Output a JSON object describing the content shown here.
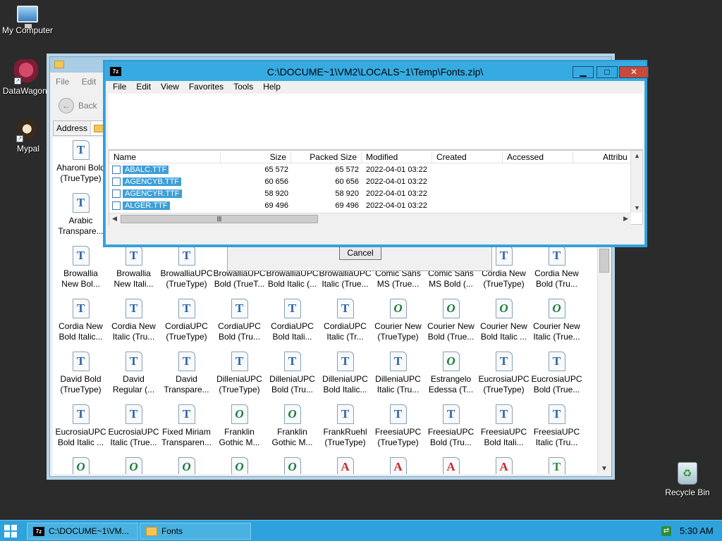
{
  "desktop": {
    "icons": [
      {
        "label": "My Computer"
      },
      {
        "label": "DataWagon."
      },
      {
        "label": "Mypal"
      },
      {
        "label": "Recycle Bin"
      }
    ]
  },
  "explorer": {
    "menu": [
      "File",
      "Edit"
    ],
    "back_label": "Back",
    "address_label": "Address",
    "cancel_label": "Cancel",
    "font_items": [
      {
        "l1": "Aharoni Bold",
        "l2": "(TrueType)",
        "icon": "tt"
      },
      {
        "l1": "Arabic",
        "l2": "Transpare...",
        "icon": "tt"
      },
      {
        "l1": "Browallia",
        "l2": "New Bol...",
        "icon": "tt"
      },
      {
        "l1": "Browallia",
        "l2": "New Itali...",
        "icon": "tt"
      },
      {
        "l1": "BrowalliaUPC",
        "l2": "(TrueType)",
        "icon": "tt"
      },
      {
        "l1": "BrowalliaUPC",
        "l2": "Bold (TrueT...",
        "icon": "tt"
      },
      {
        "l1": "BrowalliaUPC",
        "l2": "Bold Italic (...",
        "icon": "tt"
      },
      {
        "l1": "BrowalliaUPC",
        "l2": "Italic (True...",
        "icon": "tt"
      },
      {
        "l1": "Comic Sans",
        "l2": "MS (True...",
        "icon": "tt"
      },
      {
        "l1": "Comic Sans",
        "l2": "MS Bold (...",
        "icon": "tt"
      },
      {
        "l1": "Cordia New",
        "l2": "(TrueType)",
        "icon": "tt"
      },
      {
        "l1": "Cordia New",
        "l2": "Bold (Tru...",
        "icon": "tt"
      },
      {
        "l1": "Cordia New",
        "l2": "Bold Italic...",
        "icon": "tt"
      },
      {
        "l1": "Cordia New",
        "l2": "Italic (Tru...",
        "icon": "tt"
      },
      {
        "l1": "CordiaUPC",
        "l2": "(TrueType)",
        "icon": "tt"
      },
      {
        "l1": "CordiaUPC",
        "l2": "Bold (Tru...",
        "icon": "tt"
      },
      {
        "l1": "CordiaUPC",
        "l2": "Bold Itali...",
        "icon": "tt"
      },
      {
        "l1": "CordiaUPC",
        "l2": "Italic (Tr...",
        "icon": "tt"
      },
      {
        "l1": "Courier New",
        "l2": "(TrueType)",
        "icon": "ot"
      },
      {
        "l1": "Courier New",
        "l2": "Bold (True...",
        "icon": "ot"
      },
      {
        "l1": "Courier New",
        "l2": "Bold Italic ...",
        "icon": "ot"
      },
      {
        "l1": "Courier New",
        "l2": "Italic (True...",
        "icon": "ot"
      },
      {
        "l1": "David Bold",
        "l2": "(TrueType)",
        "icon": "tt"
      },
      {
        "l1": "David",
        "l2": "Regular (...",
        "icon": "tt"
      },
      {
        "l1": "David",
        "l2": "Transpare...",
        "icon": "tt"
      },
      {
        "l1": "DilleniaUPC",
        "l2": "(TrueType)",
        "icon": "tt"
      },
      {
        "l1": "DilleniaUPC",
        "l2": "Bold (Tru...",
        "icon": "tt"
      },
      {
        "l1": "DilleniaUPC",
        "l2": "Bold Italic...",
        "icon": "tt"
      },
      {
        "l1": "DilleniaUPC",
        "l2": "Italic (Tru...",
        "icon": "tt"
      },
      {
        "l1": "Estrangelo",
        "l2": "Edessa (T...",
        "icon": "ot"
      },
      {
        "l1": "EucrosiaUPC",
        "l2": "(TrueType)",
        "icon": "tt"
      },
      {
        "l1": "EucrosiaUPC",
        "l2": "Bold (True...",
        "icon": "tt"
      },
      {
        "l1": "EucrosiaUPC",
        "l2": "Bold Italic ...",
        "icon": "tt"
      },
      {
        "l1": "EucrosiaUPC",
        "l2": "Italic (True...",
        "icon": "tt"
      },
      {
        "l1": "Fixed Miriam",
        "l2": "Transparen...",
        "icon": "tt"
      },
      {
        "l1": "Franklin",
        "l2": "Gothic M...",
        "icon": "ot"
      },
      {
        "l1": "Franklin",
        "l2": "Gothic M...",
        "icon": "ot"
      },
      {
        "l1": "FrankRuehl",
        "l2": "(TrueType)",
        "icon": "tt"
      },
      {
        "l1": "FreesiaUPC",
        "l2": "(TrueType)",
        "icon": "tt"
      },
      {
        "l1": "FreesiaUPC",
        "l2": "Bold (Tru...",
        "icon": "tt"
      },
      {
        "l1": "FreesiaUPC",
        "l2": "Bold Itali...",
        "icon": "tt"
      },
      {
        "l1": "FreesiaUPC",
        "l2": "Italic (Tru...",
        "icon": "tt"
      },
      {
        "l1": "",
        "l2": "",
        "icon": "ot"
      },
      {
        "l1": "",
        "l2": "",
        "icon": "ot"
      },
      {
        "l1": "",
        "l2": "",
        "icon": "ot"
      },
      {
        "l1": "",
        "l2": "",
        "icon": "ot"
      },
      {
        "l1": "",
        "l2": "",
        "icon": "ot"
      },
      {
        "l1": "",
        "l2": "",
        "icon": "a"
      },
      {
        "l1": "",
        "l2": "",
        "icon": "a"
      },
      {
        "l1": "",
        "l2": "",
        "icon": "a"
      },
      {
        "l1": "",
        "l2": "",
        "icon": "a"
      },
      {
        "l1": "",
        "l2": "",
        "icon": "tt2"
      }
    ]
  },
  "zip": {
    "icon_text": "7z",
    "title": "C:\\DOCUME~1\\VM2\\LOCALS~1\\Temp\\Fonts.zip\\",
    "buttons": {
      "minimize": "▁",
      "maximize": "□",
      "close": "✕"
    },
    "menu": [
      "File",
      "Edit",
      "View",
      "Favorites",
      "Tools",
      "Help"
    ],
    "columns": [
      "Name",
      "Size",
      "Packed Size",
      "Modified",
      "Created",
      "Accessed",
      "Attribu"
    ],
    "rows": [
      {
        "name": "ABALC.TTF",
        "size": "65 572",
        "packed": "65 572",
        "modified": "2022-04-01 03:22"
      },
      {
        "name": "AGENCYB.TTF",
        "size": "60 656",
        "packed": "60 656",
        "modified": "2022-04-01 03:22"
      },
      {
        "name": "AGENCYR.TTF",
        "size": "58 920",
        "packed": "58 920",
        "modified": "2022-04-01 03:22"
      },
      {
        "name": "ALGER.TTF",
        "size": "69 496",
        "packed": "69 496",
        "modified": "2022-04-01 03:22"
      }
    ]
  },
  "taskbar": {
    "items": [
      {
        "label": "C:\\DOCUME~1\\VM..."
      },
      {
        "label": "Fonts"
      }
    ],
    "clock": "5:30 AM"
  }
}
